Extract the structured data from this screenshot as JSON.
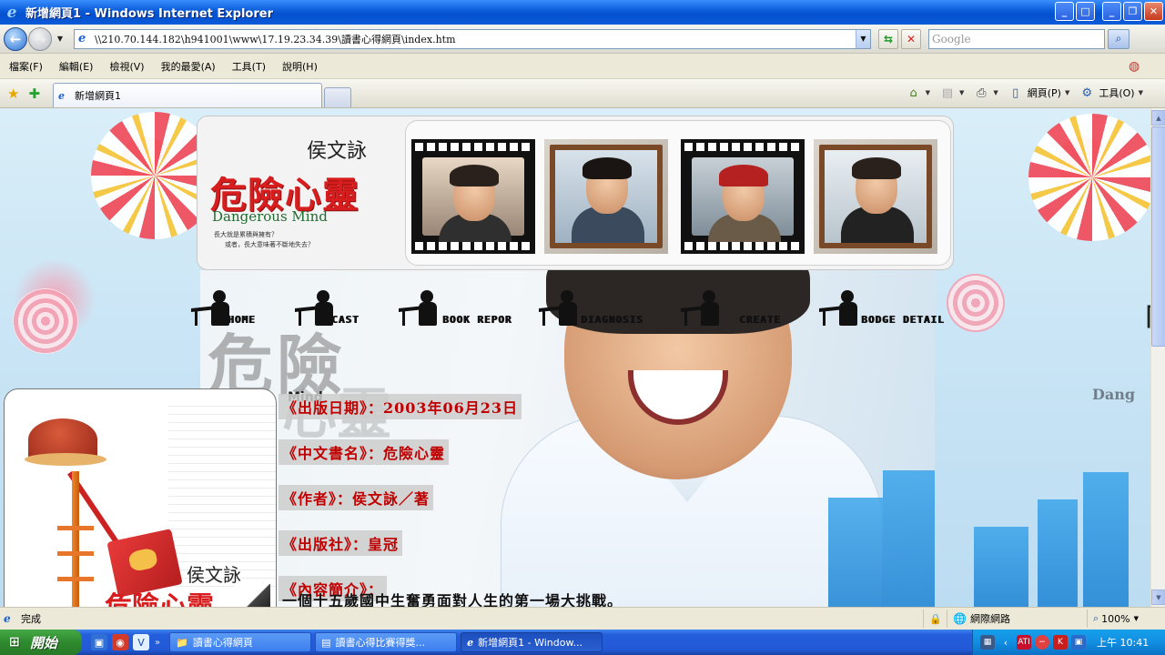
{
  "window": {
    "title": "新增網頁1 - Windows Internet Explorer",
    "controls": {
      "minimize": "_",
      "maximize": "□",
      "close": "✕"
    },
    "controls2": {
      "minimize": "_",
      "restore": "❐",
      "close": "✕"
    }
  },
  "address_bar": {
    "url": "\\\\210.70.144.182\\h941001\\www\\17.19.23.34.39\\讀書心得網頁\\index.htm",
    "search_placeholder": "Google"
  },
  "menu": {
    "items": [
      "檔案(F)",
      "編輯(E)",
      "檢視(V)",
      "我的最愛(A)",
      "工具(T)",
      "說明(H)"
    ]
  },
  "tabs": {
    "active": "新增網頁1"
  },
  "command_bar": {
    "page_label": "網頁(P)",
    "tools_label": "工具(O)"
  },
  "banner": {
    "author": "侯文詠",
    "title": "危險心靈",
    "title_en": "Dangerous Mind",
    "tagline1": "長大就是累積與擁有？",
    "tagline2": "或者，長大意味著不斷地失去？"
  },
  "nav": {
    "items": [
      "HOME",
      "CAST",
      "BOOK REPOR",
      "DIAGNOSIS",
      "CREATE",
      "BODGE DETAIL"
    ]
  },
  "side_panel": {
    "author": "侯文詠",
    "title": "危險心靈"
  },
  "right_deco": {
    "bracket": "「",
    "text": "Dang"
  },
  "info": {
    "publish_date": "《出版日期》：2003年06月23日",
    "chinese_title": "《中文書名》：危險心靈",
    "author": "《作者》：侯文詠／著",
    "publisher": "《出版社》：皇冠",
    "summary_label": "《內容簡介》：",
    "summary": "一個十五歲國中生奮勇面對人生的第一場大挑戰。"
  },
  "hero": {
    "watermark": "危險",
    "watermark2": "心靈",
    "mind": "Mind"
  },
  "status": {
    "text": "完成",
    "zone": "網際網路",
    "zoom": "100%"
  },
  "taskbar": {
    "start": "開始",
    "tasks": [
      "讀書心得網頁",
      "讀書心得比賽得獎...",
      "新增網頁1 - Window..."
    ],
    "clock": "上午 10:41"
  },
  "colors": {
    "title_bar": "#0a5ad8",
    "accent_red": "#d71d1d",
    "info_red": "#c00000",
    "taskbar": "#245edb"
  }
}
